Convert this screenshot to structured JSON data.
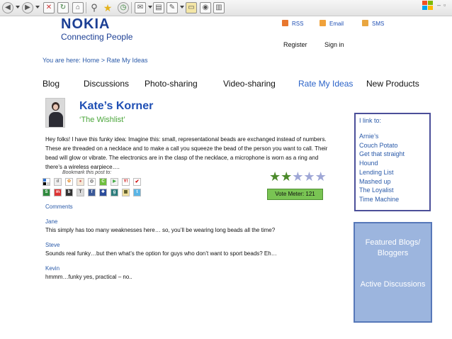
{
  "header": {
    "logo": "NOKIA",
    "tagline": "Connecting People",
    "feeds": [
      {
        "label": "RSS",
        "icon": "rss-icon",
        "color": "#e8772e"
      },
      {
        "label": "Email",
        "icon": "email-icon",
        "color": "#f0a23b"
      },
      {
        "label": "SMS",
        "icon": "sms-icon",
        "color": "#e9a640"
      }
    ],
    "register": "Register",
    "sign_in": "Sign in"
  },
  "breadcrumb": "You are here:  Home > Rate My Ideas",
  "nav": {
    "items": [
      {
        "label": "Blog"
      },
      {
        "label": "Discussions"
      },
      {
        "label": "Photo-sharing"
      },
      {
        "label": "Video-sharing"
      },
      {
        "label": "Rate My Ideas",
        "active": true
      },
      {
        "label": "New Products"
      }
    ]
  },
  "post": {
    "title": "Kate’s Korner",
    "subtitle": "‘The Wishlist’",
    "body": "Hey folks! I have this funky idea: Imagine this:  small, representational beads are exchanged instead of numbers. These are threaded on a necklace and to make a call you squeeze the bead of the person you want to call. Their bead will glow or vibrate. The electronics are in the clasp of the necklace, a microphone is worn as a ring and there’s a wireless earpiece….",
    "bookmark_label": "Bookmark this post to:",
    "rating": 2,
    "rating_max": 5,
    "vote_label": "Vote Meter: 121"
  },
  "comments": {
    "header": "Comments",
    "items": [
      {
        "name": "Jane",
        "text": "This simply has too many weaknesses here… so, you’ll be wearing long beads all the time?"
      },
      {
        "name": "Steve",
        "text": "Sounds real funky…but then what’s the option for guys who don’t want to sport beads? Eh…"
      },
      {
        "name": "Kevin",
        "text": "hmmm…funky yes, practical – no.."
      }
    ]
  },
  "sidebar": {
    "links_title": "I link to:",
    "links": [
      "Arnie’s",
      "Couch Potato",
      "Get that straight",
      "Hound",
      "Lending List",
      "Mashed up",
      "The Loyalist",
      "Time Machine"
    ],
    "featured_title": "Featured Blogs/ Bloggers",
    "active_discussions": "Active Discussions"
  },
  "colors": {
    "brand": "#1c3f94",
    "link": "#2a5aa9",
    "accent_green": "#4aa53a",
    "star_filled": "#4c8a2b",
    "star_empty": "#9fa7d6",
    "vote_bg": "#79c453",
    "featured_bg": "#9cb5de"
  }
}
